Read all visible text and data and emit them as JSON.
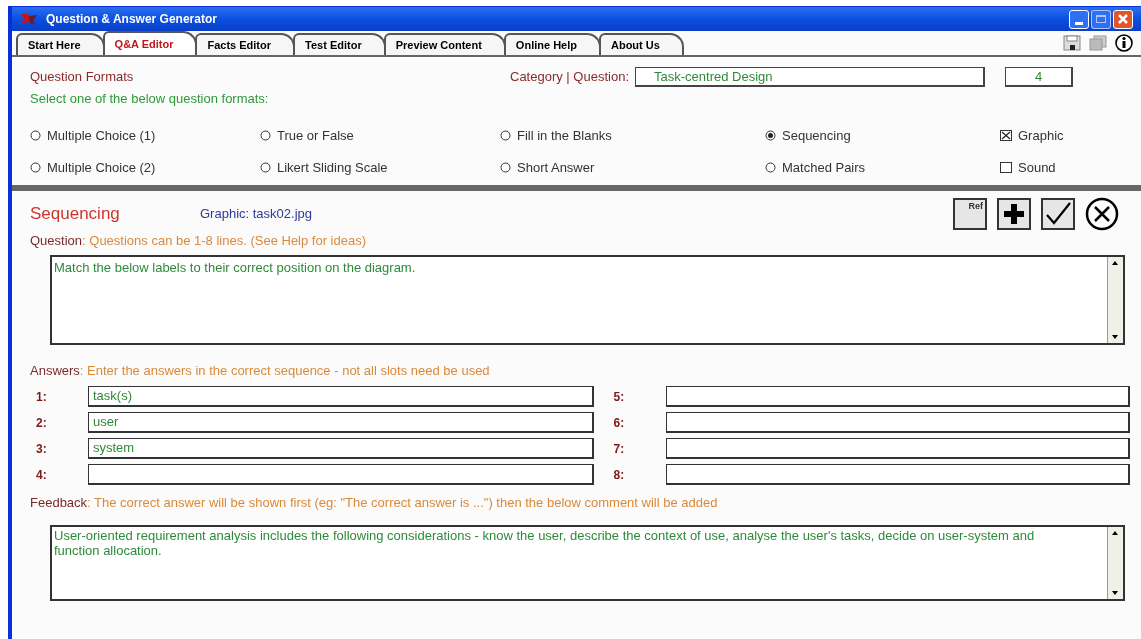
{
  "window": {
    "title": "Question & Answer Generator"
  },
  "tabs": [
    {
      "label": "Start Here",
      "selected": false
    },
    {
      "label": "Q&A Editor",
      "selected": true
    },
    {
      "label": "Facts Editor",
      "selected": false
    },
    {
      "label": "Test Editor",
      "selected": false
    },
    {
      "label": "Preview Content",
      "selected": false
    },
    {
      "label": "Online Help",
      "selected": false
    },
    {
      "label": "About Us",
      "selected": false
    }
  ],
  "formats": {
    "title": "Question Formats",
    "hint": "Select one of the below question formats:",
    "category_label": "Category | Question:",
    "category": "Task-centred Design",
    "question_number": "4",
    "options": [
      {
        "label": "Multiple Choice (1)",
        "kind": "radio",
        "selected": false
      },
      {
        "label": "True or False",
        "kind": "radio",
        "selected": false
      },
      {
        "label": "Fill in the Blanks",
        "kind": "radio",
        "selected": false
      },
      {
        "label": "Sequencing",
        "kind": "radio",
        "selected": true
      },
      {
        "label": "Graphic",
        "kind": "checkbox",
        "checked": true
      },
      {
        "label": "Multiple Choice (2)",
        "kind": "radio",
        "selected": false
      },
      {
        "label": "Likert Sliding Scale",
        "kind": "radio",
        "selected": false
      },
      {
        "label": "Short Answer",
        "kind": "radio",
        "selected": false
      },
      {
        "label": "Matched Pairs",
        "kind": "radio",
        "selected": false
      },
      {
        "label": "Sound",
        "kind": "checkbox",
        "checked": false
      }
    ]
  },
  "editor": {
    "heading": "Sequencing",
    "graphic": "Graphic: task02.jpg",
    "ref_label": "Ref",
    "question_label": "Question",
    "question_hint": ": Questions can be 1-8 lines. (See Help for ideas)",
    "question": "Match the below labels to their correct position on the diagram.",
    "answers_label": "Answers",
    "answers_hint": ": Enter the answers in the correct sequence - not all slots need be used",
    "answers": [
      {
        "number": "1:",
        "value": "task(s)"
      },
      {
        "number": "2:",
        "value": "user"
      },
      {
        "number": "3:",
        "value": "system"
      },
      {
        "number": "4:"
      },
      {
        "number": "5:"
      },
      {
        "number": "6:"
      },
      {
        "number": "7:"
      },
      {
        "number": "8:"
      }
    ],
    "feedback_label": "Feedback",
    "feedback_hint": ": The correct answer will be shown first (eg: \"The correct answer is ...\") then the below comment will be added",
    "feedback": "User-oriented requirement analysis includes the following considerations - know the user, describe the context of use, analyse the user's tasks, decide on user-system and function allocation."
  }
}
